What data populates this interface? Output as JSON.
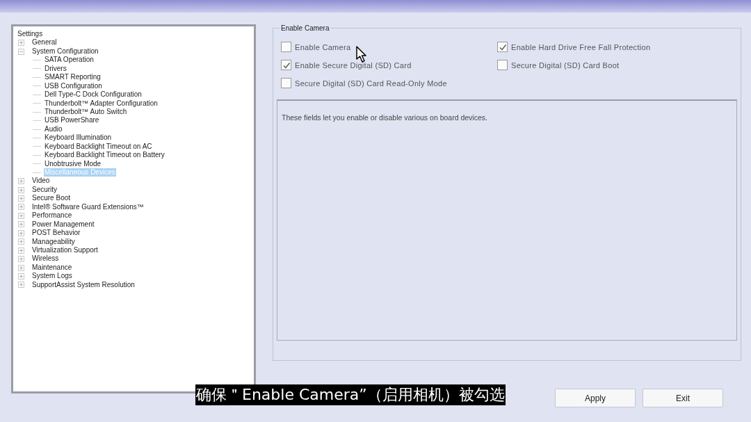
{
  "tree": {
    "root": "Settings",
    "items": [
      {
        "label": "General",
        "expanded": false,
        "selected": false
      },
      {
        "label": "System Configuration",
        "expanded": true,
        "selected": false,
        "children": [
          {
            "label": "SATA Operation",
            "selected": false
          },
          {
            "label": "Drivers",
            "selected": false
          },
          {
            "label": "SMART Reporting",
            "selected": false
          },
          {
            "label": "USB Configuration",
            "selected": false
          },
          {
            "label": "Dell Type-C Dock Configuration",
            "selected": false
          },
          {
            "label": "Thunderbolt™ Adapter Configuration",
            "selected": false
          },
          {
            "label": "Thunderbolt™ Auto Switch",
            "selected": false
          },
          {
            "label": "USB PowerShare",
            "selected": false
          },
          {
            "label": "Audio",
            "selected": false
          },
          {
            "label": "Keyboard Illumination",
            "selected": false
          },
          {
            "label": "Keyboard Backlight Timeout on AC",
            "selected": false
          },
          {
            "label": "Keyboard Backlight Timeout on Battery",
            "selected": false
          },
          {
            "label": "Unobtrusive Mode",
            "selected": false
          },
          {
            "label": "Miscellaneous Devices",
            "selected": true
          }
        ]
      },
      {
        "label": "Video",
        "expanded": false,
        "selected": false
      },
      {
        "label": "Security",
        "expanded": false,
        "selected": false
      },
      {
        "label": "Secure Boot",
        "expanded": false,
        "selected": false
      },
      {
        "label": "Intel® Software Guard Extensions™",
        "expanded": false,
        "selected": false
      },
      {
        "label": "Performance",
        "expanded": false,
        "selected": false
      },
      {
        "label": "Power Management",
        "expanded": false,
        "selected": false
      },
      {
        "label": "POST Behavior",
        "expanded": false,
        "selected": false
      },
      {
        "label": "Manageability",
        "expanded": false,
        "selected": false
      },
      {
        "label": "Virtualization Support",
        "expanded": false,
        "selected": false
      },
      {
        "label": "Wireless",
        "expanded": false,
        "selected": false
      },
      {
        "label": "Maintenance",
        "expanded": false,
        "selected": false
      },
      {
        "label": "System Logs",
        "expanded": false,
        "selected": false
      },
      {
        "label": "SupportAssist System Resolution",
        "expanded": false,
        "selected": false
      }
    ]
  },
  "group": {
    "title": "Enable Camera",
    "options": [
      {
        "label": "Enable Camera",
        "checked": false
      },
      {
        "label": "Enable Hard Drive Free Fall Protection",
        "checked": true
      },
      {
        "label": "Enable Secure Digital (SD) Card",
        "checked": true
      },
      {
        "label": "Secure Digital (SD) Card Boot",
        "checked": false
      },
      {
        "label": "Secure Digital (SD) Card Read-Only Mode",
        "checked": false
      }
    ]
  },
  "description": "These fields let you enable or disable various on board devices.",
  "buttons": [
    "Apply",
    "Exit"
  ],
  "subtitle": "确保＂Enable Camera”（启用相机）被勾选"
}
